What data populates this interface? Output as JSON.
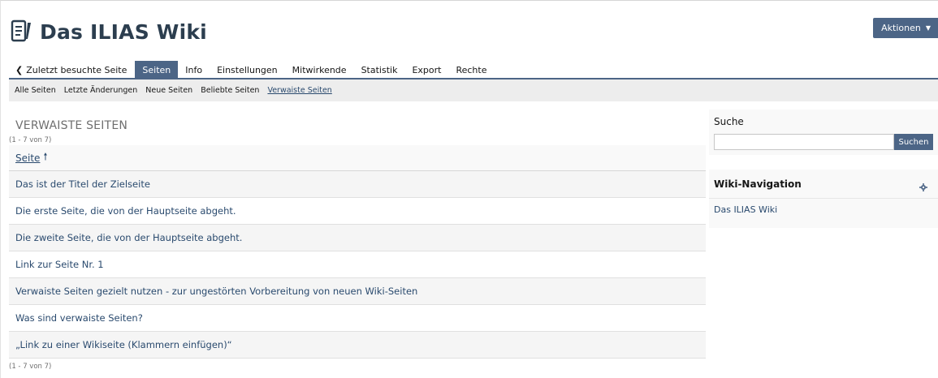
{
  "header": {
    "title": "Das ILIAS Wiki",
    "icon": "wiki-icon",
    "actions_label": "Aktionen"
  },
  "tabs": {
    "back_label": "Zuletzt besuchte Seite",
    "items": [
      "Seiten",
      "Info",
      "Einstellungen",
      "Mitwirkende",
      "Statistik",
      "Export",
      "Rechte"
    ],
    "active": "Seiten"
  },
  "subtabs": {
    "items": [
      "Alle Seiten",
      "Letzte Änderungen",
      "Neue Seiten",
      "Beliebte Seiten",
      "Verwaiste Seiten"
    ],
    "active": "Verwaiste Seiten"
  },
  "list": {
    "title": "VERWAISTE SEITEN",
    "count_top": "(1 - 7 von 7)",
    "count_bottom": "(1 - 7 von 7)",
    "column_header": "Seite",
    "rows": [
      "Das ist der Titel der Zielseite",
      "Die erste Seite, die von der Hauptseite abgeht.",
      "Die zweite Seite, die von der Hauptseite abgeht.",
      "Link zur Seite Nr. 1",
      "Verwaiste Seiten gezielt nutzen - zur ungestörten Vorbereitung von neuen Wiki-Seiten",
      "Was sind verwaiste Seiten?",
      "„Link zu einer Wikiseite (Klammern einfügen)“"
    ]
  },
  "search": {
    "title": "Suche",
    "button_label": "Suchen",
    "value": ""
  },
  "wiki_nav": {
    "title": "Wiki-Navigation",
    "item": "Das ILIAS Wiki"
  },
  "colors": {
    "accent": "#4c6586",
    "link": "#2a4a6e",
    "title": "#2c3e4f"
  }
}
